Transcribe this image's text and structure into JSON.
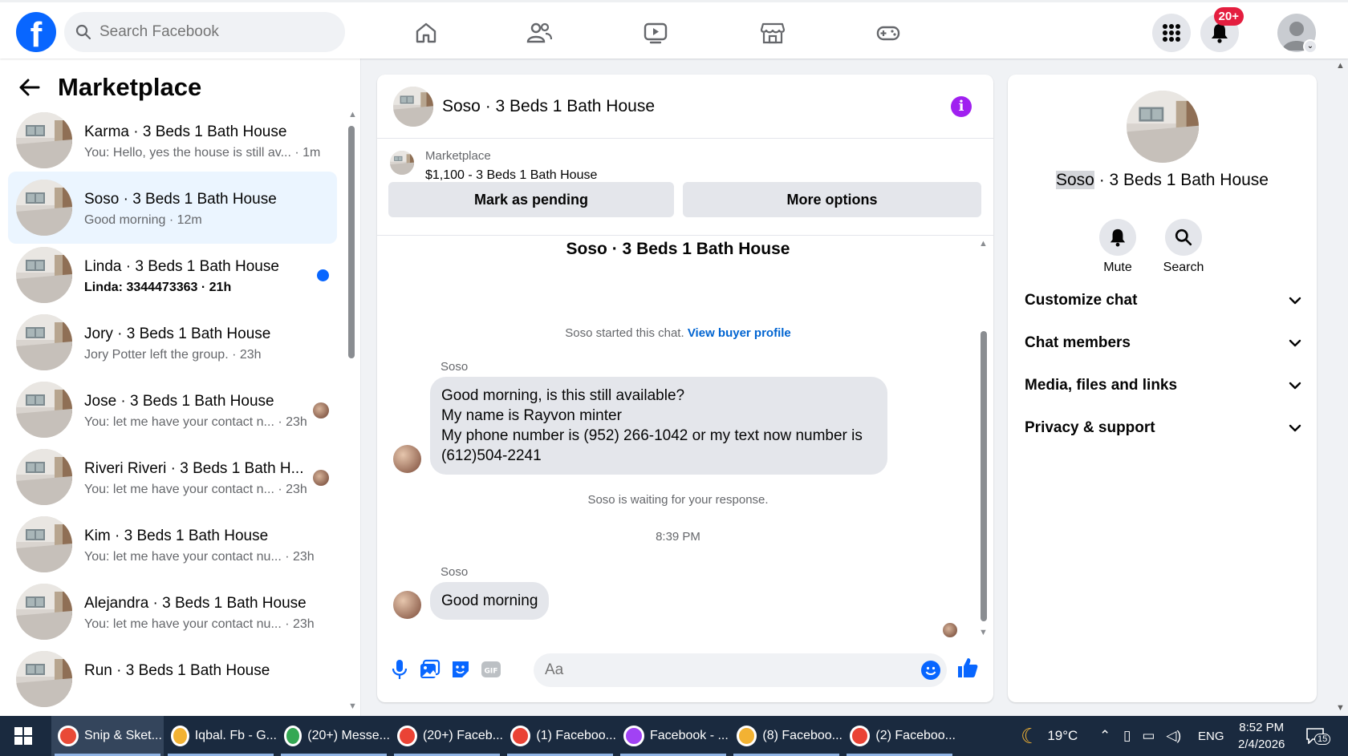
{
  "colors": {
    "brand": "#0866ff",
    "active_row": "#ebf5ff",
    "badge": "#e41e3f",
    "info": "#a020f0"
  },
  "search": {
    "placeholder": "Search Facebook"
  },
  "nav_icons": [
    "home-icon",
    "friends-icon",
    "video-icon",
    "marketplace-icon",
    "gaming-icon"
  ],
  "notifications": {
    "badge": "20+"
  },
  "sidebar": {
    "title": "Marketplace",
    "conversations": [
      {
        "title": "Karma · 3 Beds 1 Bath House",
        "subtitle": "You: Hello, yes the house is still av... · 1m",
        "active": false,
        "unread": false,
        "seen": false
      },
      {
        "title": "Soso · 3 Beds 1 Bath House",
        "subtitle": "Good morning · 12m",
        "active": true,
        "unread": false,
        "seen": false
      },
      {
        "title": "Linda · 3 Beds 1 Bath House",
        "subtitle": "Linda: 3344473363 · 21h",
        "active": false,
        "unread": true,
        "seen": false
      },
      {
        "title": "Jory · 3 Beds 1 Bath House",
        "subtitle": "Jory Potter left the group. · 23h",
        "active": false,
        "unread": false,
        "seen": false
      },
      {
        "title": "Jose · 3 Beds 1 Bath House",
        "subtitle": "You: let me have your contact n... · 23h",
        "active": false,
        "unread": false,
        "seen": true
      },
      {
        "title": "Riveri Riveri · 3 Beds 1 Bath H...",
        "subtitle": "You: let me have your contact n... · 23h",
        "active": false,
        "unread": false,
        "seen": true
      },
      {
        "title": "Kim · 3 Beds 1 Bath House",
        "subtitle": "You: let me have your contact nu... · 23h",
        "active": false,
        "unread": false,
        "seen": false
      },
      {
        "title": "Alejandra · 3 Beds 1 Bath House",
        "subtitle": "You: let me have your contact nu... · 23h",
        "active": false,
        "unread": false,
        "seen": false
      },
      {
        "title": "Run · 3 Beds 1 Bath House",
        "subtitle": "",
        "active": false,
        "unread": false,
        "seen": false
      }
    ]
  },
  "chat": {
    "title": "Soso · 3 Beds 1 Bath House",
    "marketplace_label": "Marketplace",
    "listing": "$1,100 - 3 Beds 1 Bath House",
    "mark_pending": "Mark as pending",
    "more_options": "More options",
    "thread_title": "Soso · 3 Beds 1 Bath House",
    "started_text": "Soso started this chat.",
    "buyer_link": "View buyer profile",
    "sender_1": "Soso",
    "message_1": [
      "Good morning, is this still available?",
      "My name is Rayvon minter",
      "My phone number is (952) 266-1042 or my text now number is",
      "(612)504-2241"
    ],
    "waiting_text": "Soso is waiting for your response.",
    "timestamp": "8:39 PM",
    "sender_2": "Soso",
    "message_2": "Good morning",
    "input_placeholder": "Aa"
  },
  "right_panel": {
    "name_highlight": "Soso",
    "name_rest": " · 3 Beds 1 Bath House",
    "mute_label": "Mute",
    "search_label": "Search",
    "sections": [
      "Customize chat",
      "Chat members",
      "Media, files and links",
      "Privacy & support"
    ]
  },
  "taskbar": {
    "items": [
      {
        "label": "Snip & Sket...",
        "color": "#e94a37",
        "active": true
      },
      {
        "label": "Iqbal. Fb - G...",
        "color": "#f2b233",
        "active": false
      },
      {
        "label": "(20+) Messe...",
        "color": "#34a853",
        "active": false
      },
      {
        "label": "(20+) Faceb...",
        "color": "#ea4335",
        "active": false
      },
      {
        "label": "(1) Faceboo...",
        "color": "#ea4335",
        "active": false
      },
      {
        "label": "Facebook - ...",
        "color": "#a142f4",
        "active": false
      },
      {
        "label": "(8) Faceboo...",
        "color": "#f2b233",
        "active": false
      },
      {
        "label": "(2) Faceboo...",
        "color": "#ea4335",
        "active": false
      }
    ],
    "weather": "19°C",
    "language": "ENG",
    "time": "8:52 PM",
    "date": "2/4/2026",
    "notif_count": "15"
  }
}
